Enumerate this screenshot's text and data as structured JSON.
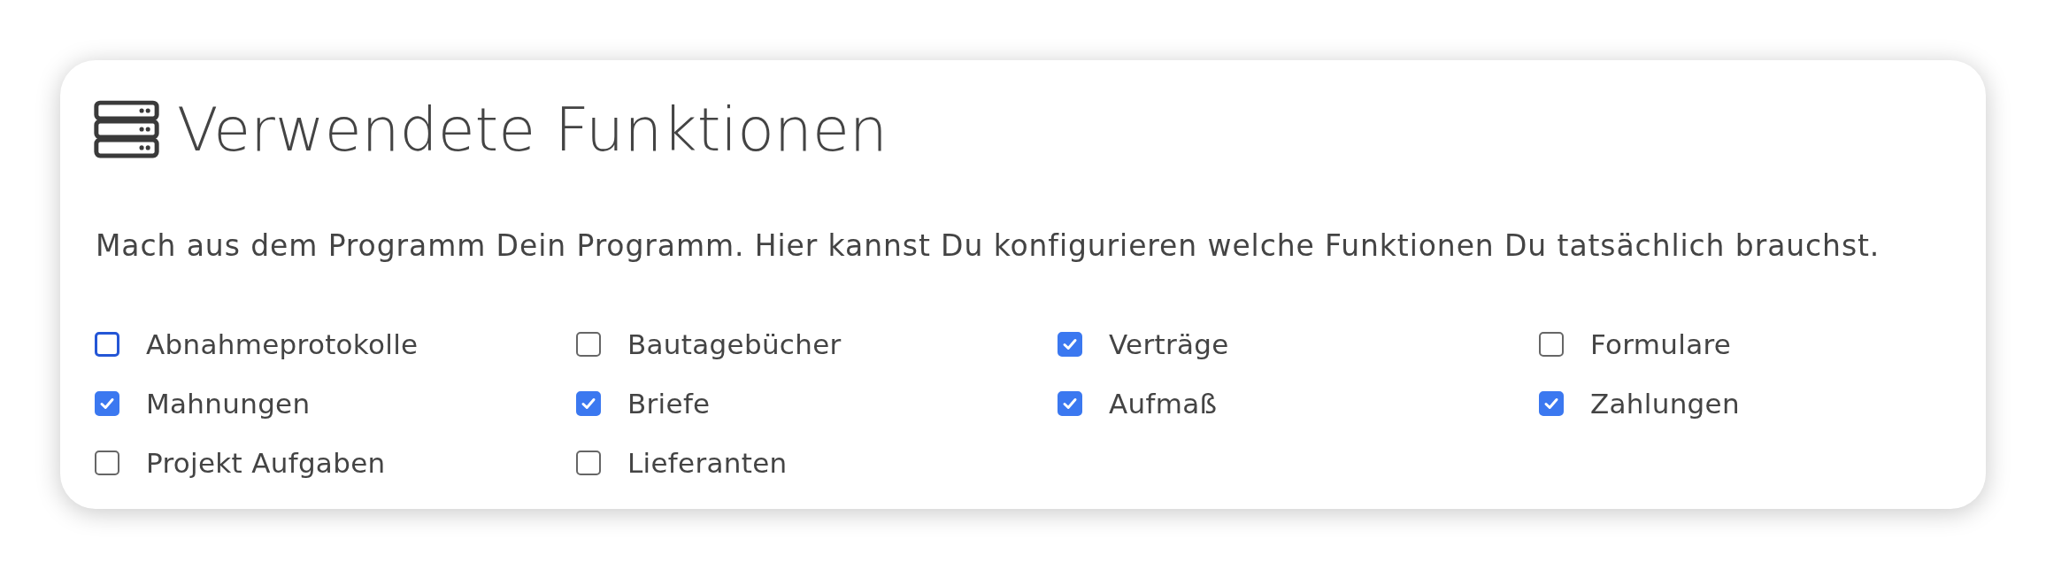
{
  "card": {
    "title": "Verwendete Funktionen",
    "description": "Mach aus dem Programm Dein Programm. Hier kannst Du konfigurieren welche Funktionen Du tatsächlich brauchst.",
    "features": [
      {
        "label": "Abnahmeprotokolle",
        "checked": false,
        "focused": true
      },
      {
        "label": "Bautagebücher",
        "checked": false,
        "focused": false
      },
      {
        "label": "Verträge",
        "checked": true,
        "focused": false
      },
      {
        "label": "Formulare",
        "checked": false,
        "focused": false
      },
      {
        "label": "Mahnungen",
        "checked": true,
        "focused": false
      },
      {
        "label": "Briefe",
        "checked": true,
        "focused": false
      },
      {
        "label": "Aufmaß",
        "checked": true,
        "focused": false
      },
      {
        "label": "Zahlungen",
        "checked": true,
        "focused": false
      },
      {
        "label": "Projekt Aufgaben",
        "checked": false,
        "focused": false
      },
      {
        "label": "Lieferanten",
        "checked": false,
        "focused": false
      }
    ]
  }
}
